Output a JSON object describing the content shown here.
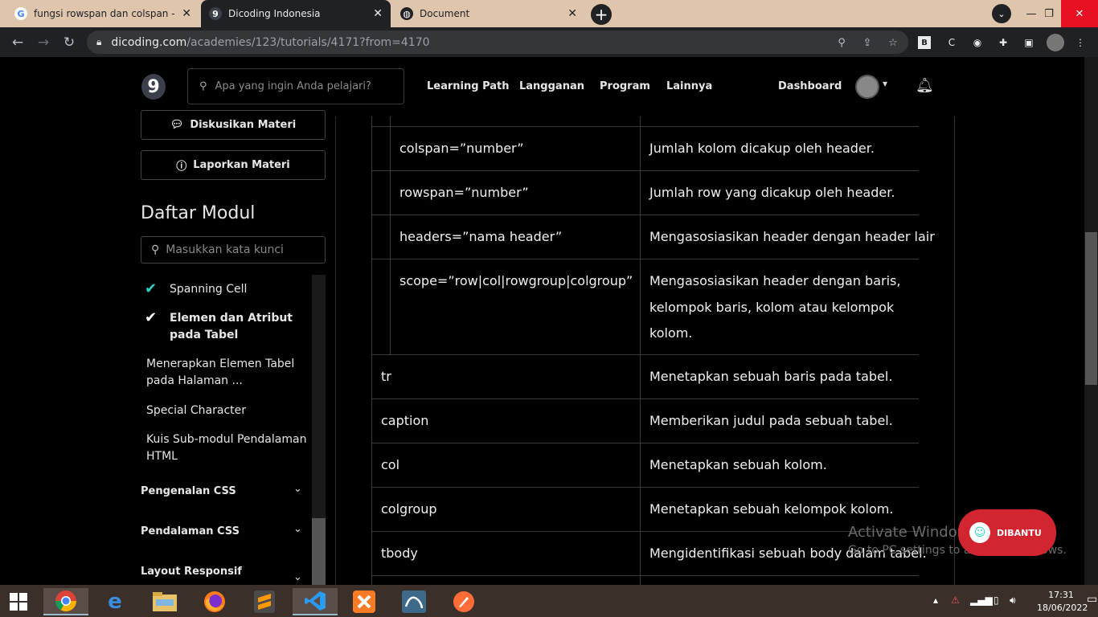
{
  "browser": {
    "tabs": [
      {
        "title": "fungsi rowspan dan colspan - Pe",
        "favicon": "G"
      },
      {
        "title": "Dicoding Indonesia",
        "favicon": "9"
      },
      {
        "title": "Document",
        "favicon": "globe"
      }
    ],
    "url_host": "dicoding.com",
    "url_path": "/academies/123/tutorials/4171?from=4170"
  },
  "header": {
    "logo": "9",
    "search_placeholder": "Apa yang ingin Anda pelajari?",
    "nav": [
      "Learning Path",
      "Langganan",
      "Program",
      "Lainnya"
    ],
    "dashboard": "Dashboard"
  },
  "sidebar": {
    "discuss_label": "Diskusikan Materi",
    "report_label": "Laporkan Materi",
    "module_title": "Daftar Modul",
    "search_placeholder": "Masukkan kata kunci",
    "items": [
      {
        "label": "Spanning Cell",
        "done": true
      },
      {
        "label": "Elemen dan Atribut pada Tabel",
        "done": true,
        "active": true
      },
      {
        "label": "Menerapkan Elemen Tabel pada Halaman ...",
        "done": false
      },
      {
        "label": "Special Character",
        "done": false
      },
      {
        "label": "Kuis Sub-modul Pendalaman HTML",
        "done": false
      }
    ],
    "sections": [
      "Pengenalan CSS",
      "Pendalaman CSS",
      "Layout Responsif"
    ]
  },
  "table": {
    "sub_rows": [
      {
        "attr": "colspan=”number”",
        "desc": [
          "Jumlah kolom dicakup oleh header."
        ]
      },
      {
        "attr": "rowspan=”number”",
        "desc": [
          "Jumlah row yang dicakup oleh header."
        ]
      },
      {
        "attr": "headers=”nama header”",
        "desc": [
          "Mengasosiasikan header dengan header lair"
        ]
      },
      {
        "attr": "scope=”row|col|rowgroup|colgroup”",
        "desc": [
          "Mengasosiasikan header dengan baris,",
          "kelompok baris, kolom atau kelompok",
          "kolom."
        ]
      }
    ],
    "rows": [
      {
        "elem": "tr",
        "desc": "Menetapkan sebuah baris pada tabel."
      },
      {
        "elem": "caption",
        "desc": "Memberikan judul pada sebuah tabel."
      },
      {
        "elem": "col",
        "desc": "Menetapkan sebuah kolom."
      },
      {
        "elem": "colgroup",
        "desc": "Menetapkan sebuah kelompok kolom."
      },
      {
        "elem": "tbody",
        "desc": "Mengidentifikasi sebuah body dalam tabel."
      }
    ]
  },
  "overlay": {
    "watermark_title": "Activate Windows",
    "watermark_sub": "Go to PC settings to activate Windows.",
    "help_label": "DIBANTU"
  },
  "taskbar": {
    "time": "17:31",
    "date": "18/06/2022"
  }
}
